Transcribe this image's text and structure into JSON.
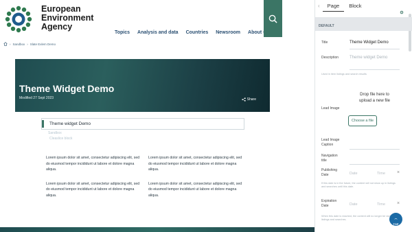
{
  "brand": {
    "line1": "European",
    "line2": "Environment",
    "line3": "Agency"
  },
  "nav": [
    "Topics",
    "Analysis and data",
    "Countries",
    "Newsroom",
    "About us"
  ],
  "breadcrumb": {
    "home_icon": "home-icon",
    "items": [
      "Sandbox",
      "Slate Exlem Demo"
    ]
  },
  "hero": {
    "title": "Theme Widget Demo",
    "modified": "Modified 27 Sept 2023",
    "share": "Share"
  },
  "editor": {
    "title_value": "Theme widget Demo",
    "sub1": "Sandbox",
    "sub2": "Cleaslice block"
  },
  "lorem": [
    "Lorem ipsum dolor sit amet, consectetur adipiscing elit, sed do eiusmod tempor incididunt ut labore et dolore magna aliqua.",
    "Lorem ipsum dolor sit amet, consectetur adipiscing elit, sed do eiusmod tempor incididunt ut labore et dolore magna aliqua.",
    "Lorem ipsum dolor sit amet, consectetur adipiscing elit, sed do eiusmod tempor incididunt ut labore et dolore magna aliqua.",
    "Lorem ipsum dolor sit amet, consectetur adipiscing elit, sed do eiusmod tempor incididunt ut labore et dolore magna aliqua."
  ],
  "sidebar": {
    "tabs": [
      "Page",
      "Block"
    ],
    "section": "DEFAULT",
    "title_label": "Title",
    "title_value": "Theme Widget Demo",
    "description_label": "Description",
    "description_placeholder": "Theme widget Demo",
    "description_help": "Used in item listings and search results",
    "lead_image_label": "Lead Image",
    "drop_text_1": "Drop file here to",
    "drop_text_2": "upload a new file",
    "choose_file": "Choose a file",
    "caption_label_1": "Lead Image",
    "caption_label_2": "Caption",
    "nav_title_label_1": "Navigation",
    "nav_title_label_2": "title",
    "publishing_label_1": "Publishing",
    "publishing_label_2": "Date",
    "publishing_date_ph": "Date",
    "publishing_time_ph": "Time",
    "publishing_help": "If this date is in the future, the content will not show up in listings and searches until this date.",
    "expiration_label_1": "Expiration",
    "expiration_label_2": "Date",
    "expiration_date_ph": "Date",
    "expiration_time_ph": "Time",
    "expiration_help": "When this date is reached, the content will no longer be visible in listings and searches."
  },
  "top_button": "TOP",
  "colors": {
    "accent": "#3b7565",
    "brand_blue": "#2a4f72",
    "top_button": "#1b6aa5"
  }
}
